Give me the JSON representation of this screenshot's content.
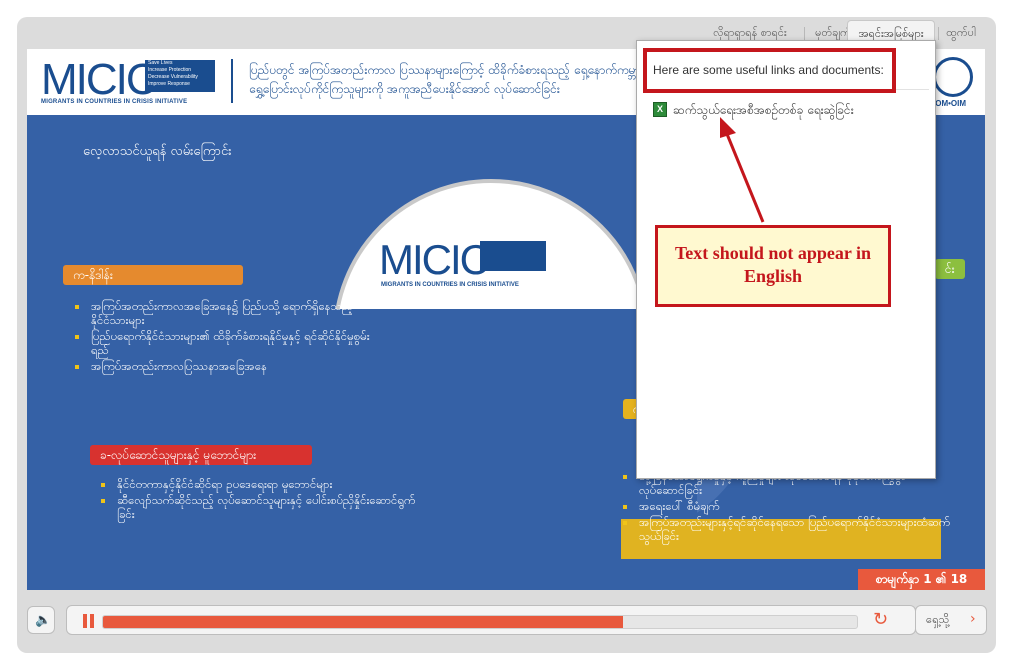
{
  "nav": {
    "tabs": [
      {
        "label": "လိုရာရှာရန် စာရင်း"
      },
      {
        "label": "မှတ်ချက်"
      },
      {
        "label": "အရင်းအမြစ်များ"
      },
      {
        "label": "ထွက်ပါ"
      }
    ]
  },
  "header": {
    "logo_text": "MICIC",
    "logo_tagline": [
      "Save Lives",
      "Increase Protection",
      "Decrease Vulnerability",
      "Improve Response"
    ],
    "logo_subtitle": "MIGRANTS IN COUNTRIES IN CRISIS INITIATIVE",
    "title": "ပြည်ပတွင် အကြပ်အတည်းကာလ ပြဿနာများကြောင့် ထိခိုက်ခံစားရသည့် ရှေ့နောက်ကမ္ဘာရွှေ့ပြောင်းလုပ်ကိုင်ကြသူများကို အကူအညီပေးနိုင်အောင် လုပ်ဆောင်ခြင်း",
    "iom_label": "IOM•OIM"
  },
  "slide": {
    "intro": "လေ့လာသင်ယူရန် လမ်းကြောင်း",
    "center_logo": "MICIC",
    "center_subtitle": "MIGRANTS IN COUNTRIES IN CRISIS INITIATIVE",
    "section_a": {
      "label": "က-နိဒါန်း",
      "items": [
        "အကြပ်အတည်းကာလအခြေအနေ၌ ပြည်ပသို့ ရောက်ရှိနေသည့်နိုင်ငံသားများ",
        "ပြည်ပရောက်နိုင်ငံသားများ၏ ထိခိုက်ခံစားရနိုင်မှုနှင့် ရင်ဆိုင်နိုင်မှုစွမ်းရည်",
        "အကြပ်အတည်းကာလပြဿနာအခြေအနေ"
      ]
    },
    "section_b": {
      "label": "ခ-လုပ်ဆောင်သူများနှင့် မူဘောင်များ",
      "items": [
        "နိုင်ငံတကာနှင့်နိုင်ငံဆိုင်ရာ ဥပဒေရေးရာ မူဘောင်များ",
        "ဆီလျော်သက်ဆိုင်သည့် လုပ်ဆောင်သူများနှင့် ပေါင်းစပ်ညှိနှိုင်းဆောင်ရွက်ခြင်း"
      ]
    },
    "section_c": {
      "label": "ဂ",
      "items": [
        "တုံ့ပြန်ဆောင်ရွက်မှုနှင့် ကူညီမှုများ လုပ်ဆောင်ရန် ပိုမိုတက်ကြွစွာ လုပ်ဆောင်ခြင်း",
        "အရေးပေါ် စီမံချက်",
        "အကြပ်အတည်းများနှင့်ရင်ဆိုင်နေရသော ပြည်ပရောက်နိုင်ငံသားများထံဆက်သွယ်ခြင်း"
      ]
    },
    "section_d": {
      "label": "င်း"
    },
    "counter": "စာမျက်နှာ 1 ၏ 18"
  },
  "popup": {
    "heading": "Here are some useful links and documents:",
    "items": [
      {
        "label": "ဆက်သွယ်ရေးအစီအစဥ်တစ်ခု ရေးဆွဲခြင်း",
        "icon": "excel-icon"
      }
    ]
  },
  "annotation": {
    "note": "Text should not appear in English"
  },
  "controls": {
    "next_label": "ရှေ့သို့",
    "progress": 0.69,
    "accent": "#e8593d"
  }
}
